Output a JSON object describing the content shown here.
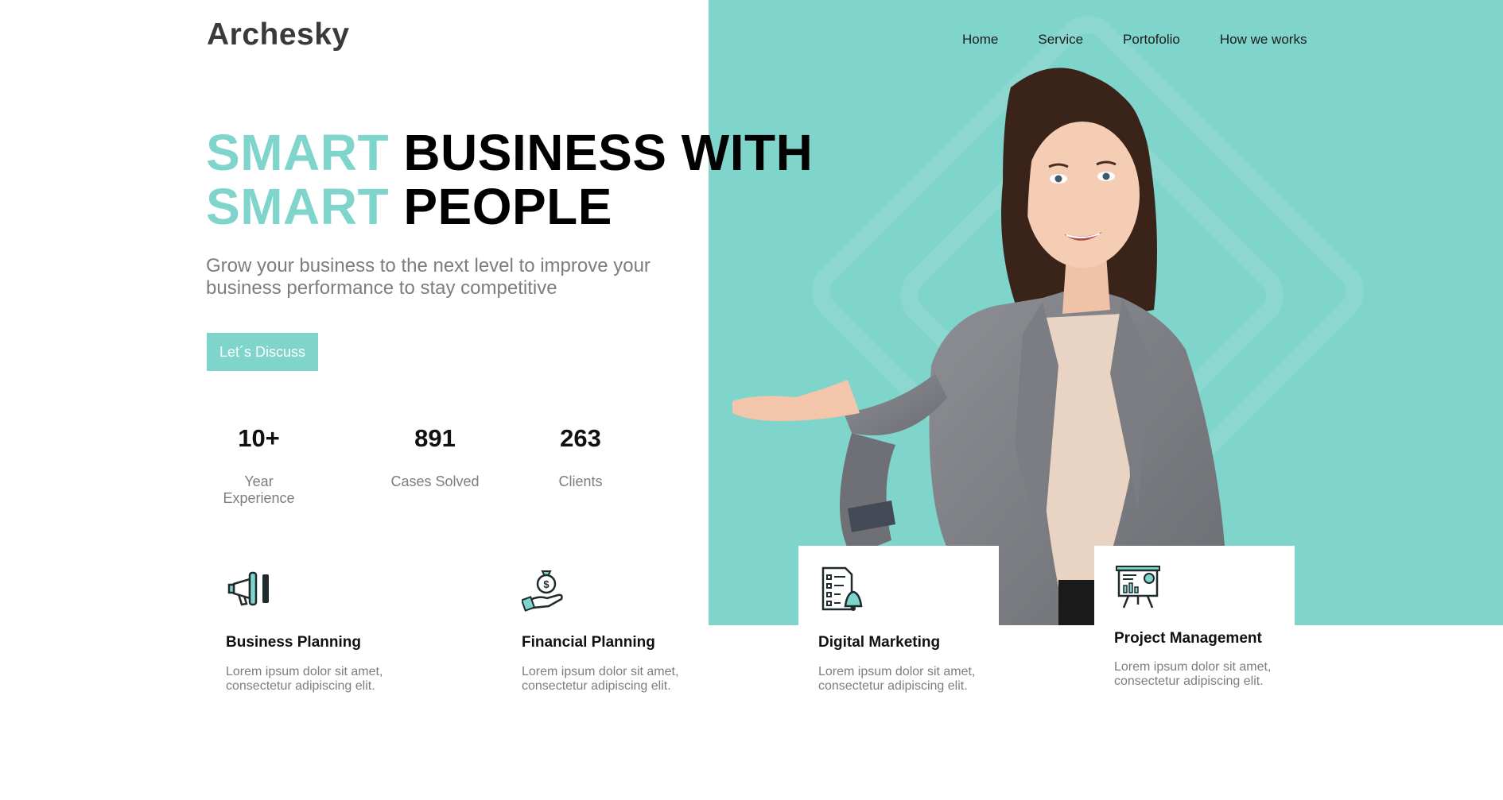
{
  "brand": {
    "logo": "Archesky",
    "accent_color": "#7fd4cb"
  },
  "nav": {
    "items": [
      "Home",
      "Service",
      "Portofolio",
      "How we works"
    ]
  },
  "hero": {
    "line1_accent": "SMART",
    "line1_rest": "BUSINESS WITH",
    "line2_accent": "SMART",
    "line2_rest": "PEOPLE",
    "subtitle": "Grow your business to the next level to improve your business performance to stay competitive",
    "cta_label": "Let´s Discuss"
  },
  "stats": [
    {
      "value": "10+",
      "label": "Year Experience"
    },
    {
      "value": "891",
      "label": "Cases Solved"
    },
    {
      "value": "263",
      "label": "Clients"
    }
  ],
  "services": [
    {
      "icon": "megaphone-icon",
      "title": "Business Planning",
      "desc": "Lorem ipsum dolor sit amet, consectetur adipiscing elit."
    },
    {
      "icon": "money-bag-hand-icon",
      "title": "Financial Planning",
      "desc": "Lorem ipsum dolor sit amet, consectetur adipiscing elit."
    },
    {
      "icon": "checklist-bell-icon",
      "title": "Digital Marketing",
      "desc": "Lorem ipsum dolor sit amet, consectetur adipiscing elit."
    },
    {
      "icon": "presentation-board-icon",
      "title": "Project Management",
      "desc": "Lorem ipsum dolor sit amet, consectetur adipiscing elit."
    }
  ]
}
